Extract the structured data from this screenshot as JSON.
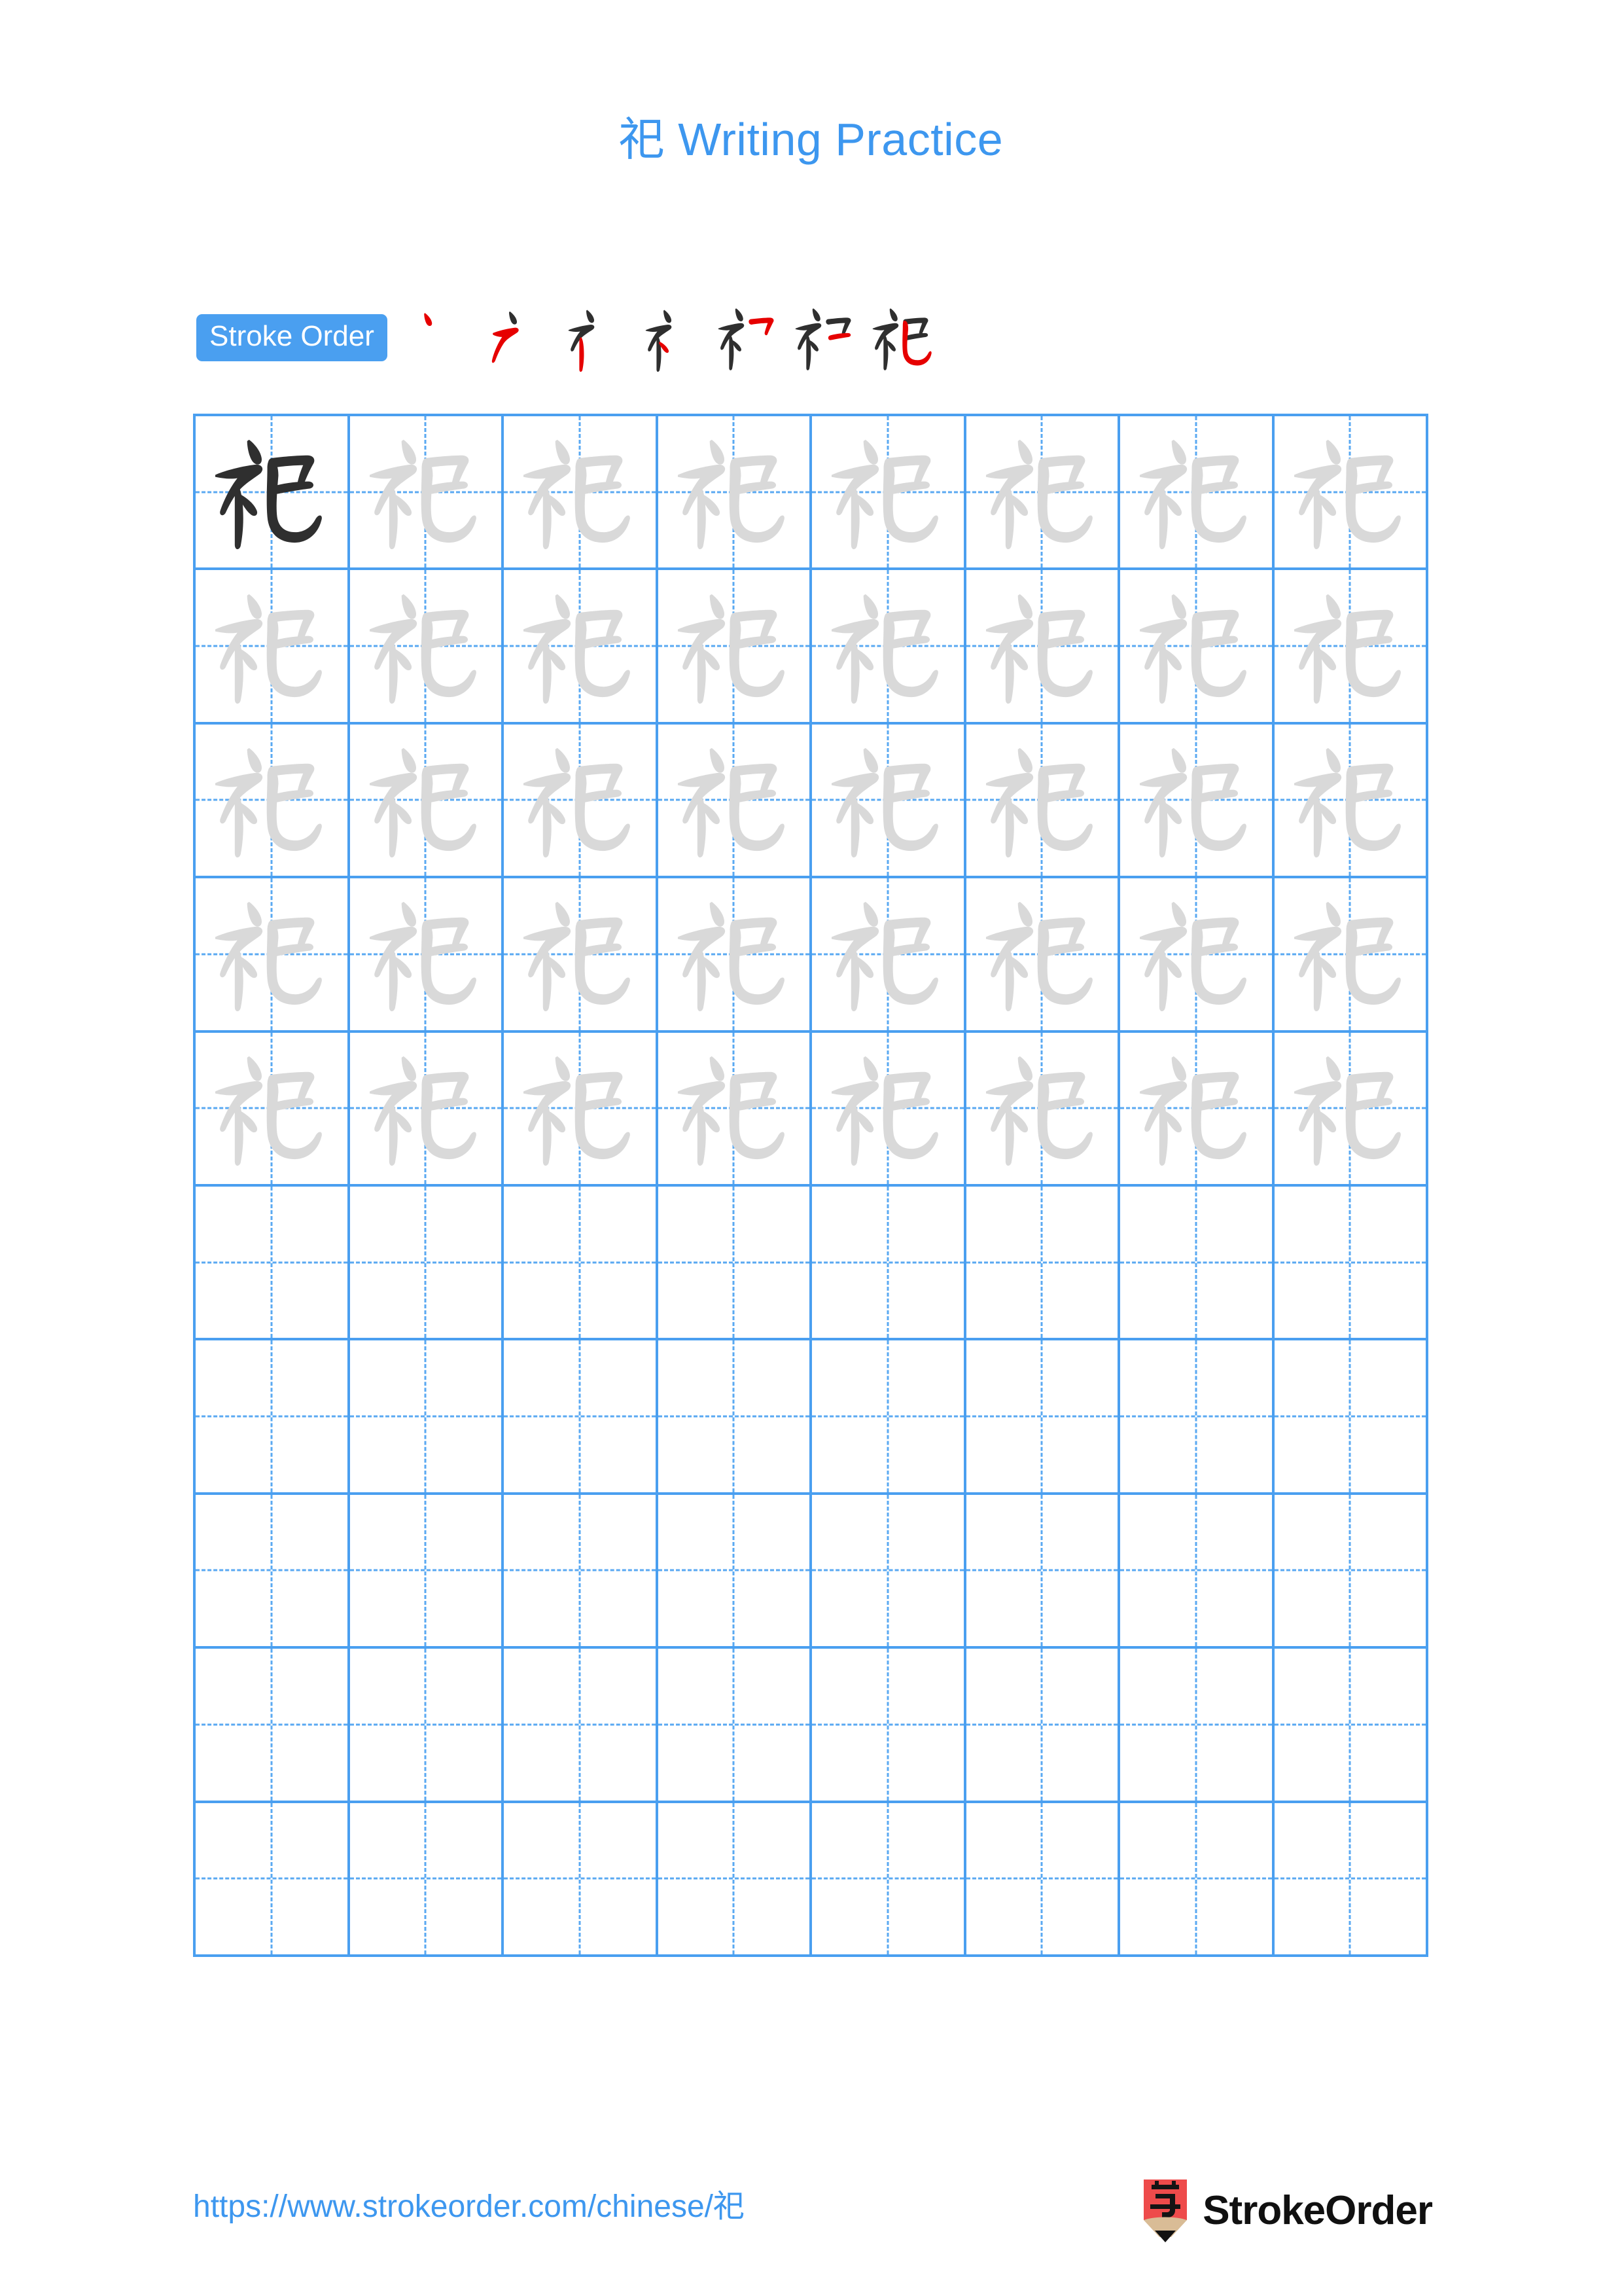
{
  "page": {
    "background_color": "#ffffff",
    "accent_color": "#3d97ef",
    "grid_line_color": "#4a9ff0",
    "stroke_new_color": "#e60000",
    "stroke_done_color": "#2f2f2f",
    "trace_color": "#d9d9d9"
  },
  "header": {
    "character": "祀",
    "title": "祀 Writing Practice"
  },
  "stroke_order": {
    "badge_label": "Stroke Order",
    "total_strokes": 7,
    "steps": [
      {
        "index": 1,
        "label": "丶",
        "new_stroke": 1
      },
      {
        "index": 2,
        "label": "㇆",
        "new_stroke": 2
      },
      {
        "index": 3,
        "label": "礻",
        "new_stroke": 3
      },
      {
        "index": 4,
        "label": "礻",
        "new_stroke": 4
      },
      {
        "index": 5,
        "label": "礻フ",
        "new_stroke": 5
      },
      {
        "index": 6,
        "label": "礻コ",
        "new_stroke": 6
      },
      {
        "index": 7,
        "label": "祀",
        "new_stroke": 7
      }
    ]
  },
  "practice_grid": {
    "columns": 8,
    "rows": 10,
    "filled_rows": 5,
    "empty_rows": 5,
    "model_cell": {
      "row": 1,
      "column": 1,
      "style": "dark"
    },
    "trace_character": "祀",
    "cell_guides": "dashed-cross"
  },
  "footer": {
    "url": "https://www.strokeorder.com/chinese/祀",
    "brand_name": "StrokeOrder",
    "brand_mark": "pencil-logo",
    "brand_mark_character": "字",
    "brand_mark_color": "#ee4b4b",
    "brand_mark_wood_color": "#d9bc96"
  }
}
